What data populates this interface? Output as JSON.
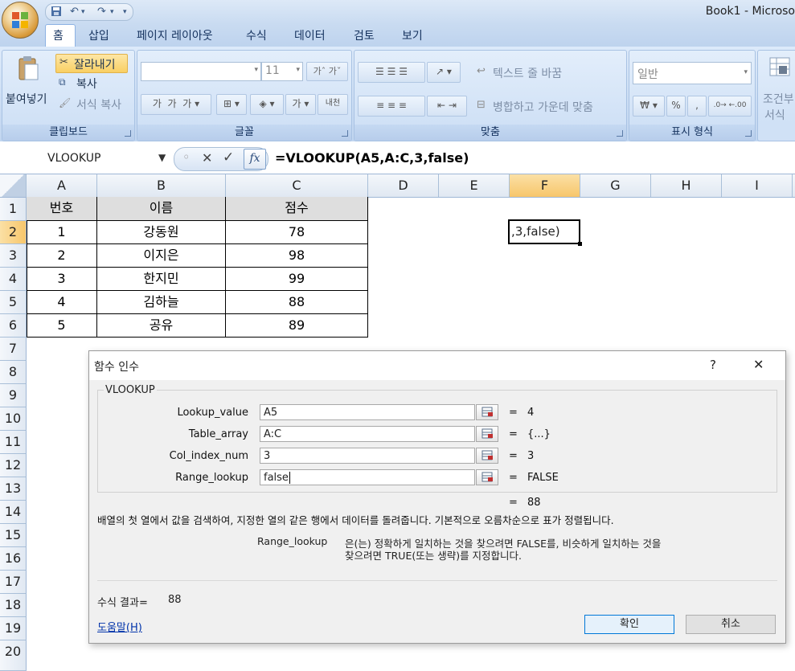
{
  "window": {
    "title": "Book1 - Microso"
  },
  "tabs": [
    "홈",
    "삽입",
    "페이지 레이아웃",
    "수식",
    "데이터",
    "검토",
    "보기"
  ],
  "ribbon": {
    "clipboard": {
      "paste": "붙여넣기",
      "cut": "잘라내기",
      "copy": "복사",
      "format_painter": "서식 복사",
      "label": "클립보드"
    },
    "font": {
      "size": "11",
      "label": "글꼴",
      "cell_style_btn": "내천"
    },
    "alignment": {
      "wrap_text": "텍스트 줄 바꿈",
      "merge_center": "병합하고 가운데 맞춤",
      "label": "맞춤"
    },
    "number": {
      "format": "일반",
      "currency": "₩",
      "percent": "%",
      "comma": ",",
      "label": "표시 형식"
    },
    "styles": {
      "conditional_line1": "조건부",
      "conditional_line2": "서식"
    }
  },
  "formula_bar": {
    "name_box": "VLOOKUP",
    "formula": "=VLOOKUP(A5,A:C,3,false)"
  },
  "columns": [
    "A",
    "B",
    "C",
    "D",
    "E",
    "F",
    "G",
    "H",
    "I"
  ],
  "rows": [
    "1",
    "2",
    "3",
    "4",
    "5",
    "6",
    "7",
    "8",
    "9",
    "10",
    "11",
    "12",
    "13",
    "14",
    "15",
    "16",
    "17",
    "18",
    "19",
    "20"
  ],
  "table": {
    "headers": [
      "번호",
      "이름",
      "점수"
    ],
    "rows": [
      [
        "1",
        "강동원",
        "78"
      ],
      [
        "2",
        "이지은",
        "98"
      ],
      [
        "3",
        "한지민",
        "99"
      ],
      [
        "4",
        "김하늘",
        "88"
      ],
      [
        "5",
        "공유",
        "89"
      ]
    ]
  },
  "active_cell": {
    "ref": "F2",
    "text": ",3,false)"
  },
  "dialog": {
    "title": "함수 인수",
    "help_glyph": "?",
    "close_glyph": "✕",
    "function_name": "VLOOKUP",
    "args": [
      {
        "label": "Lookup_value",
        "value": "A5",
        "result": "4"
      },
      {
        "label": "Table_array",
        "value": "A:C",
        "result": "{...}"
      },
      {
        "label": "Col_index_num",
        "value": "3",
        "result": "3"
      },
      {
        "label": "Range_lookup",
        "value": "false",
        "result": "FALSE"
      }
    ],
    "equals": "=",
    "overall_result": "88",
    "description": "배열의 첫 열에서 값을 검색하여, 지정한 열의 같은 행에서 데이터를 돌려줍니다. 기본적으로 오름차순으로 표가 정렬됩니다.",
    "arg_help_name": "Range_lookup",
    "arg_help_line1": "은(는) 정확하게 일치하는 것을 찾으려면 FALSE를, 비슷하게 일치하는 것을",
    "arg_help_line2": "찾으려면 TRUE(또는 생략)를 지정합니다.",
    "formula_result_label": "수식 결과=",
    "formula_result_value": "88",
    "help_link": "도움말(H)",
    "ok": "확인",
    "cancel": "취소"
  }
}
